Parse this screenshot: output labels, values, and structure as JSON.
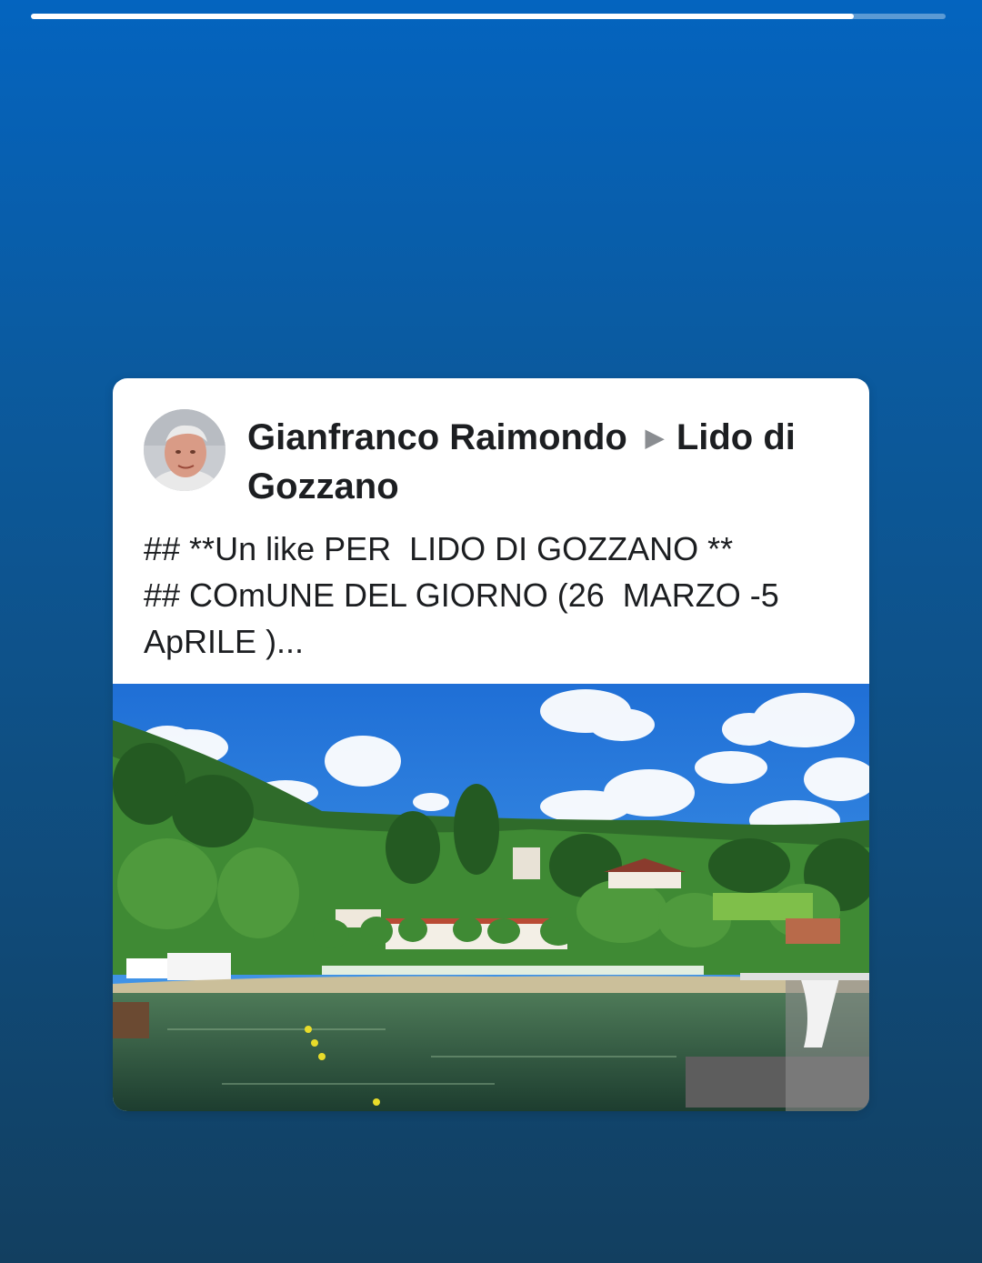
{
  "story": {
    "progress_fraction": 0.9
  },
  "post": {
    "author": "Gianfranco Raimondo",
    "separator_icon": "triangle-right-icon",
    "target": "Lido di Gozzano",
    "text": "## **Un like PER  LIDO DI GOZZANO **\n## COmUNE DEL GIORNO (26  MARZO -5 ApRILE )..."
  },
  "colors": {
    "bg_top": "#0464bf",
    "bg_bottom": "#123f60",
    "card": "#ffffff",
    "text": "#1c1e21",
    "separator": "#8a8d91"
  }
}
